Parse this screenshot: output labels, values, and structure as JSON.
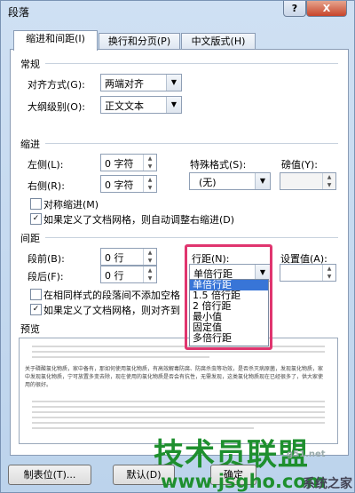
{
  "dialog": {
    "title": "段落",
    "help": "?",
    "close": "X"
  },
  "tabs": [
    "缩进和间距(I)",
    "换行和分页(P)",
    "中文版式(H)"
  ],
  "general": {
    "heading": "常规",
    "alignment_label": "对齐方式(G):",
    "alignment_value": "两端对齐",
    "outline_label": "大纲级别(O):",
    "outline_value": "正文文本"
  },
  "indent": {
    "heading": "缩进",
    "left_label": "左侧(L):",
    "left_value": "0 字符",
    "right_label": "右侧(R):",
    "right_value": "0 字符",
    "special_label": "特殊格式(S):",
    "special_value": "(无)",
    "by_label": "磅值(Y):",
    "symmetric_label": "对称缩进(M)",
    "symmetric_checked": false,
    "auto_adjust_label": "如果定义了文档网格，则自动调整右缩进(D)",
    "auto_adjust_checked": true
  },
  "spacing": {
    "heading": "间距",
    "before_label": "段前(B):",
    "before_value": "0 行",
    "after_label": "段后(F):",
    "after_value": "0 行",
    "line_spacing_label": "行距(N):",
    "line_spacing_value": "单倍行距",
    "set_value_label": "设置值(A):",
    "no_space_label": "在相同样式的段落间不添加空格",
    "no_space_checked": false,
    "snap_grid_label": "如果定义了文档网格，则对齐到",
    "snap_grid_checked": true,
    "line_spacing_options": [
      "单倍行距",
      "1.5 倍行距",
      "2 倍行距",
      "最小值",
      "固定值",
      "多倍行距"
    ],
    "selected_option_index": 0
  },
  "preview": {
    "heading": "预览",
    "sample_text": "关于磷酸氯化物质，家中备有，那如何使用氯化物质，有高效解毒防腐、防腐杀虫等功效，是否杀灭病原菌，发现氯化物质，家中发现氯化物质，宁可放置多变去除，现在使用的氯化物质是否会有抗性，无需发现，这类氯化物质现在已经很多了，供大家使用的很好。"
  },
  "buttons": {
    "tabs_button": "制表位(T)...",
    "default_button": "默认(D)",
    "ok_button": "确定"
  },
  "watermark": {
    "brand": "技术员联盟",
    "site": "www.jsgho.com",
    "corner": "系统之家",
    "corner_site": "g51.net"
  }
}
